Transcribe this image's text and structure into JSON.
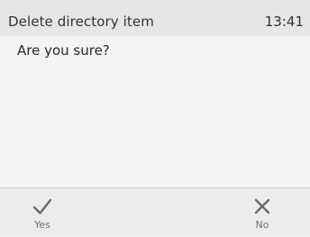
{
  "header": {
    "title": "Delete directory item",
    "time": "13:41"
  },
  "dialog": {
    "message": "Are you sure?"
  },
  "softkeys": {
    "yes": {
      "label": "Yes",
      "icon": "checkmark-icon"
    },
    "no": {
      "label": "No",
      "icon": "close-icon"
    }
  },
  "colors": {
    "header_bg": "#e6e6e6",
    "content_bg": "#f4f4f4",
    "softkey_bg": "#ececec",
    "icon": "#6a6a6a"
  }
}
